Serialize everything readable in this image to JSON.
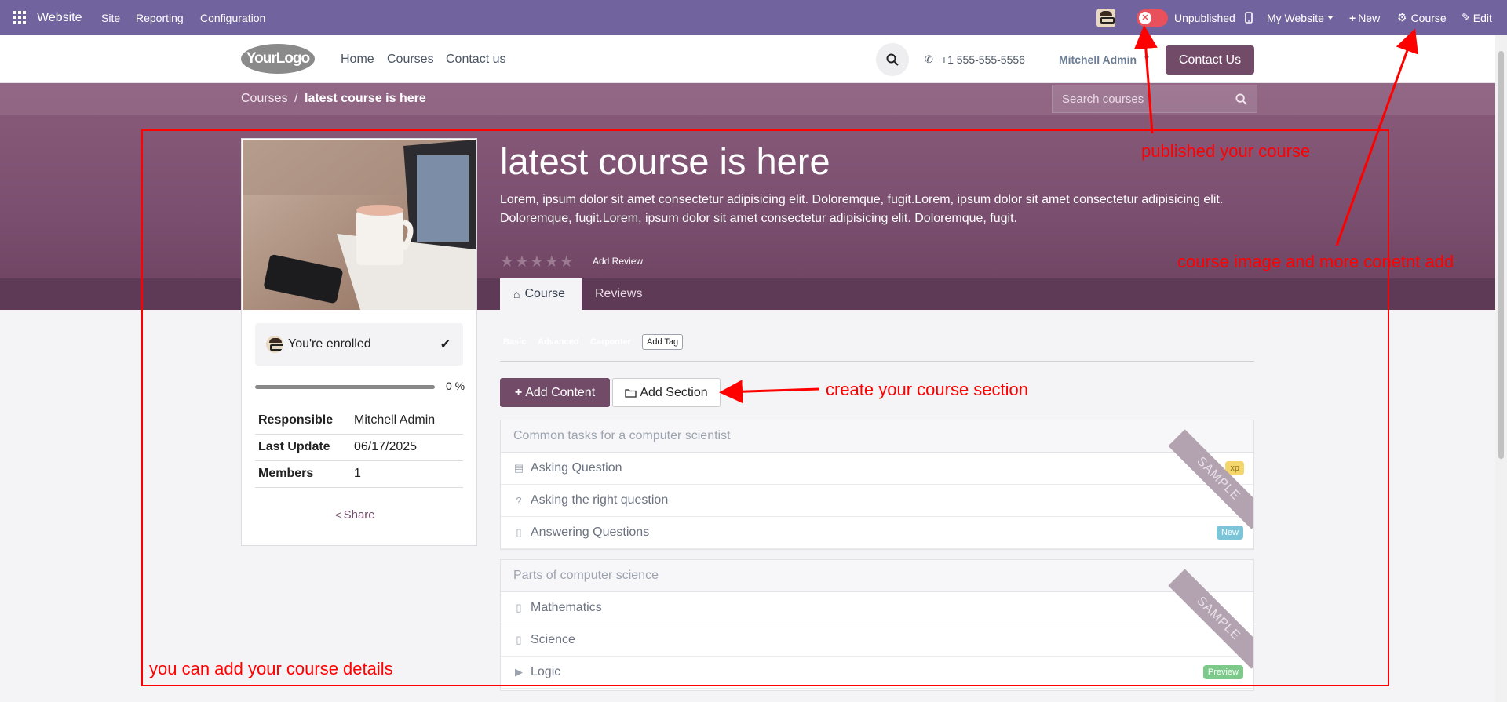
{
  "topbar": {
    "app_name": "Website",
    "menu": [
      "Site",
      "Reporting",
      "Configuration"
    ],
    "publish_status": "Unpublished",
    "website_selector": "My Website",
    "new_label": "New",
    "course_label": "Course",
    "edit_label": "Edit",
    "colors": {
      "bar": "#71639e",
      "toggle_off": "#e8505b"
    }
  },
  "header": {
    "logo_text": "YourLogo",
    "nav": [
      "Home",
      "Courses",
      "Contact us"
    ],
    "phone": "+1 555-555-5556",
    "user": "Mitchell Admin",
    "contact_button": "Contact Us",
    "brand_color": "#714b67"
  },
  "breadcrumb": {
    "root": "Courses",
    "separator": "/",
    "current": "latest course is here"
  },
  "search": {
    "placeholder": "Search courses"
  },
  "course": {
    "title": "latest course is here",
    "description": "Lorem, ipsum dolor sit amet consectetur adipisicing elit. Doloremque, fugit.Lorem, ipsum dolor sit amet consectetur adipisicing elit. Doloremque, fugit.Lorem, ipsum dolor sit amet consectetur adipisicing elit. Doloremque, fugit.",
    "rating_stars": 0,
    "add_review": "Add Review",
    "tabs": [
      "Course",
      "Reviews"
    ]
  },
  "sidebar": {
    "enrolled_label": "You're enrolled",
    "progress_percent": 0,
    "progress_label": "0 %",
    "info": [
      {
        "label": "Responsible",
        "value": "Mitchell Admin"
      },
      {
        "label": "Last Update",
        "value": "06/17/2025"
      },
      {
        "label": "Members",
        "value": "1"
      }
    ],
    "share_label": "Share"
  },
  "tags": [
    {
      "label": "Basic",
      "color": "#5cb85c"
    },
    {
      "label": "Advanced",
      "color": "#e74c3c"
    },
    {
      "label": "Carpenter",
      "color": "#9b59d6"
    }
  ],
  "add_tag": "Add Tag",
  "actions": {
    "add_content": "Add Content",
    "add_section": "Add Section"
  },
  "sections": [
    {
      "title": "Common tasks for a computer scientist",
      "ribbon": "SAMPLE",
      "items": [
        {
          "icon": "document-icon",
          "label": "Asking Question",
          "badge": "xp",
          "badge_color": "#f5d66b"
        },
        {
          "icon": "question-icon",
          "label": "Asking the right question",
          "badge": "",
          "badge_color": ""
        },
        {
          "icon": "pdf-icon",
          "label": "Answering Questions",
          "badge": "New",
          "badge_color": "#7cc4d8"
        }
      ]
    },
    {
      "title": "Parts of computer science",
      "ribbon": "SAMPLE",
      "items": [
        {
          "icon": "pdf-icon",
          "label": "Mathematics",
          "badge": "",
          "badge_color": ""
        },
        {
          "icon": "pdf-icon",
          "label": "Science",
          "badge": "",
          "badge_color": ""
        },
        {
          "icon": "play-icon",
          "label": "Logic",
          "badge": "Preview",
          "badge_color": "#7cc98a"
        }
      ]
    }
  ],
  "annotations": {
    "published": "published your course",
    "image_content": "course image and more conetnt add",
    "section": "create your course section",
    "details": "you can add your course details",
    "color": "#ff0000"
  }
}
